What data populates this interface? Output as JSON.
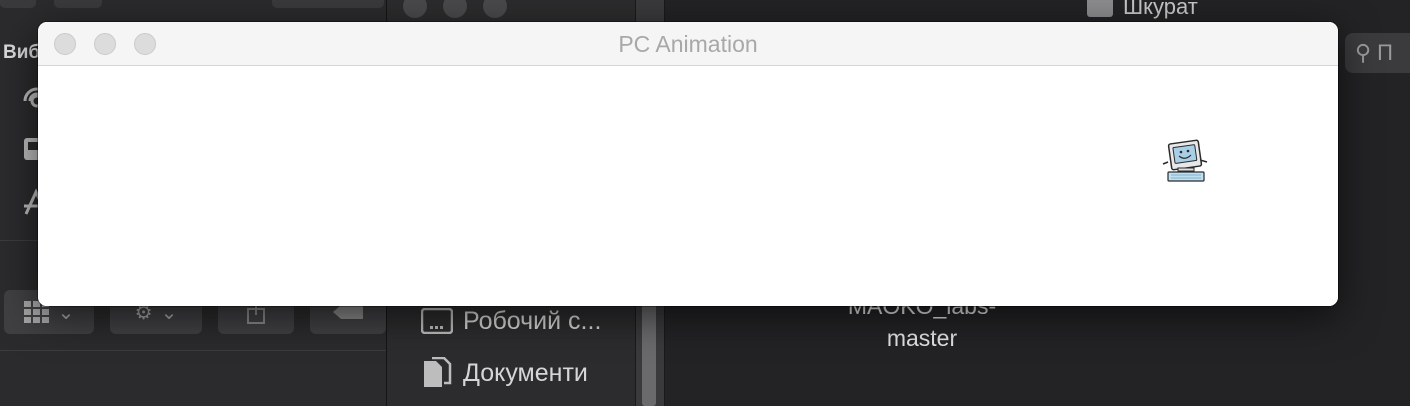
{
  "window": {
    "title": "PC Animation"
  },
  "background": {
    "left_panel": {
      "heading": "Виб"
    },
    "finder": {
      "folder_title": "Шкурат",
      "search_placeholder": "П",
      "sidebar_items": [
        {
          "label": "Робочий с...",
          "icon": "desktop-icon"
        },
        {
          "label": "Документи",
          "icon": "documents-icon"
        }
      ],
      "file": {
        "label_line1": "MAOKO_labs-",
        "label_line2": "master"
      }
    }
  },
  "sprite": {
    "name": "computer-character",
    "colors": {
      "screen": "#a9cfe6",
      "keyboard": "#bfe0f0",
      "outline": "#2a2a2a"
    }
  }
}
